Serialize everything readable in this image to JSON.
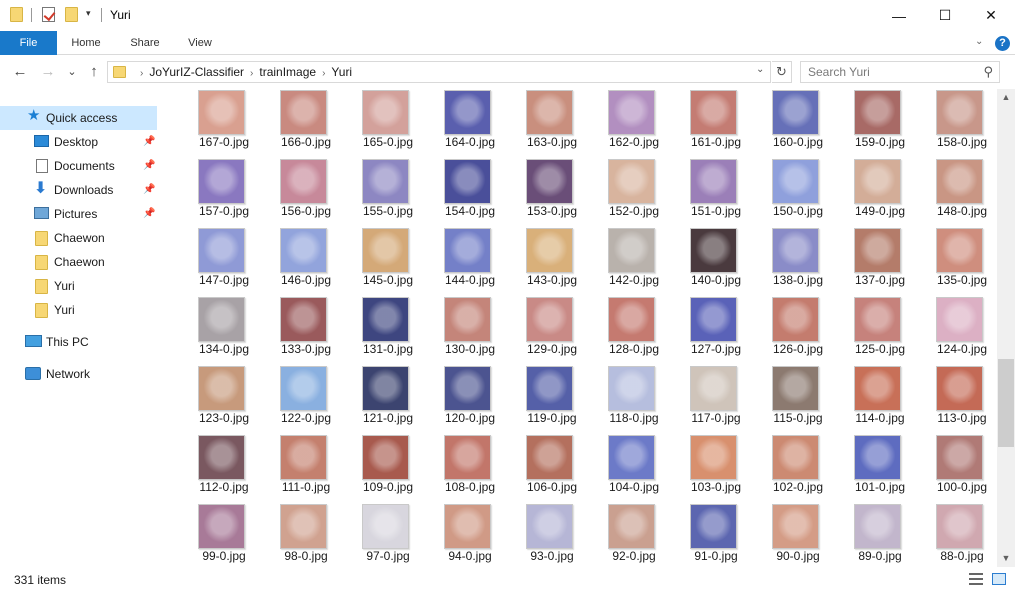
{
  "window": {
    "title": "Yuri"
  },
  "window_controls": {
    "minimize": "—",
    "maximize": "☐",
    "close": "✕"
  },
  "ribbon": {
    "tabs": [
      "File",
      "Home",
      "Share",
      "View"
    ],
    "help": "?"
  },
  "nav": {
    "back": "←",
    "forward": "→",
    "recent": "⌄",
    "up": "↑"
  },
  "breadcrumb": [
    "JoYurIZ-Classifier",
    "trainImage",
    "Yuri"
  ],
  "search": {
    "placeholder": "Search Yuri"
  },
  "sidebar": {
    "items": [
      {
        "label": "Quick access",
        "icon": "star-icon"
      },
      {
        "label": "Desktop",
        "icon": "desktop-icon",
        "pinned": true
      },
      {
        "label": "Documents",
        "icon": "documents-icon",
        "pinned": true
      },
      {
        "label": "Downloads",
        "icon": "downloads-icon",
        "pinned": true
      },
      {
        "label": "Pictures",
        "icon": "pictures-icon",
        "pinned": true
      },
      {
        "label": "Chaewon",
        "icon": "folder-icon"
      },
      {
        "label": "Chaewon",
        "icon": "folder-icon"
      },
      {
        "label": "Yuri",
        "icon": "folder-icon"
      },
      {
        "label": "Yuri",
        "icon": "folder-icon"
      },
      {
        "label": "This PC",
        "icon": "this-pc-icon"
      },
      {
        "label": "Network",
        "icon": "network-icon"
      }
    ]
  },
  "files": [
    {
      "name": "167-0.jpg",
      "color": "#d9a090"
    },
    {
      "name": "166-0.jpg",
      "color": "#c98a80"
    },
    {
      "name": "165-0.jpg",
      "color": "#d3a19b"
    },
    {
      "name": "164-0.jpg",
      "color": "#5a5fae"
    },
    {
      "name": "163-0.jpg",
      "color": "#c98f7e"
    },
    {
      "name": "162-0.jpg",
      "color": "#b28fc0"
    },
    {
      "name": "161-0.jpg",
      "color": "#c47c73"
    },
    {
      "name": "160-0.jpg",
      "color": "#6670b8"
    },
    {
      "name": "159-0.jpg",
      "color": "#a86a66"
    },
    {
      "name": "158-0.jpg",
      "color": "#c8978a"
    },
    {
      "name": "157-0.jpg",
      "color": "#8a78c0"
    },
    {
      "name": "156-0.jpg",
      "color": "#c7899a"
    },
    {
      "name": "155-0.jpg",
      "color": "#8d87c2"
    },
    {
      "name": "154-0.jpg",
      "color": "#4a4f9a"
    },
    {
      "name": "153-0.jpg",
      "color": "#6a4e78"
    },
    {
      "name": "152-0.jpg",
      "color": "#d8b49e"
    },
    {
      "name": "151-0.jpg",
      "color": "#9b7fb8"
    },
    {
      "name": "150-0.jpg",
      "color": "#8fa0dc"
    },
    {
      "name": "149-0.jpg",
      "color": "#d3ad98"
    },
    {
      "name": "148-0.jpg",
      "color": "#c99684"
    },
    {
      "name": "147-0.jpg",
      "color": "#8f9ad6"
    },
    {
      "name": "146-0.jpg",
      "color": "#92a4dc"
    },
    {
      "name": "145-0.jpg",
      "color": "#d4a978"
    },
    {
      "name": "144-0.jpg",
      "color": "#7480c8"
    },
    {
      "name": "143-0.jpg",
      "color": "#d9b07a"
    },
    {
      "name": "142-0.jpg",
      "color": "#b9b2ac"
    },
    {
      "name": "140-0.jpg",
      "color": "#4a3a3e"
    },
    {
      "name": "138-0.jpg",
      "color": "#8a8cc8"
    },
    {
      "name": "137-0.jpg",
      "color": "#b47c6a"
    },
    {
      "name": "135-0.jpg",
      "color": "#cf8e7e"
    },
    {
      "name": "134-0.jpg",
      "color": "#a8a2a6"
    },
    {
      "name": "133-0.jpg",
      "color": "#9a5a5c"
    },
    {
      "name": "131-0.jpg",
      "color": "#3e4680"
    },
    {
      "name": "130-0.jpg",
      "color": "#c4857a"
    },
    {
      "name": "129-0.jpg",
      "color": "#c98a86"
    },
    {
      "name": "128-0.jpg",
      "color": "#c57a70"
    },
    {
      "name": "127-0.jpg",
      "color": "#5a62b8"
    },
    {
      "name": "126-0.jpg",
      "color": "#c47c6e"
    },
    {
      "name": "125-0.jpg",
      "color": "#c6827c"
    },
    {
      "name": "124-0.jpg",
      "color": "#dcb0c4"
    },
    {
      "name": "123-0.jpg",
      "color": "#c79a7c"
    },
    {
      "name": "122-0.jpg",
      "color": "#8ab0e0"
    },
    {
      "name": "121-0.jpg",
      "color": "#3c4470"
    },
    {
      "name": "120-0.jpg",
      "color": "#4c5490"
    },
    {
      "name": "119-0.jpg",
      "color": "#5560a8"
    },
    {
      "name": "118-0.jpg",
      "color": "#b6bede"
    },
    {
      "name": "117-0.jpg",
      "color": "#cfc4ba"
    },
    {
      "name": "115-0.jpg",
      "color": "#8c7a70"
    },
    {
      "name": "114-0.jpg",
      "color": "#c87058"
    },
    {
      "name": "113-0.jpg",
      "color": "#c46a56"
    },
    {
      "name": "112-0.jpg",
      "color": "#7a5860"
    },
    {
      "name": "111-0.jpg",
      "color": "#c4806e"
    },
    {
      "name": "109-0.jpg",
      "color": "#a85a4e"
    },
    {
      "name": "108-0.jpg",
      "color": "#c2766a"
    },
    {
      "name": "106-0.jpg",
      "color": "#b4705e"
    },
    {
      "name": "104-0.jpg",
      "color": "#6c7ac8"
    },
    {
      "name": "103-0.jpg",
      "color": "#d8906e"
    },
    {
      "name": "102-0.jpg",
      "color": "#cc8a72"
    },
    {
      "name": "101-0.jpg",
      "color": "#5e6cc0"
    },
    {
      "name": "100-0.jpg",
      "color": "#b07a76"
    },
    {
      "name": "99-0.jpg",
      "color": "#a87a98"
    },
    {
      "name": "98-0.jpg",
      "color": "#d0a290"
    },
    {
      "name": "97-0.jpg",
      "color": "#d8d6de"
    },
    {
      "name": "94-0.jpg",
      "color": "#d09a86"
    },
    {
      "name": "93-0.jpg",
      "color": "#b6b6d6"
    },
    {
      "name": "92-0.jpg",
      "color": "#caa090"
    },
    {
      "name": "91-0.jpg",
      "color": "#5c66b0"
    },
    {
      "name": "90-0.jpg",
      "color": "#d49c86"
    },
    {
      "name": "89-0.jpg",
      "color": "#c2b6cc"
    },
    {
      "name": "88-0.jpg",
      "color": "#d0a8b0"
    }
  ],
  "status": {
    "item_count": "331 items"
  },
  "colors": {
    "accent": "#1979ca",
    "selection": "#cce8ff"
  }
}
